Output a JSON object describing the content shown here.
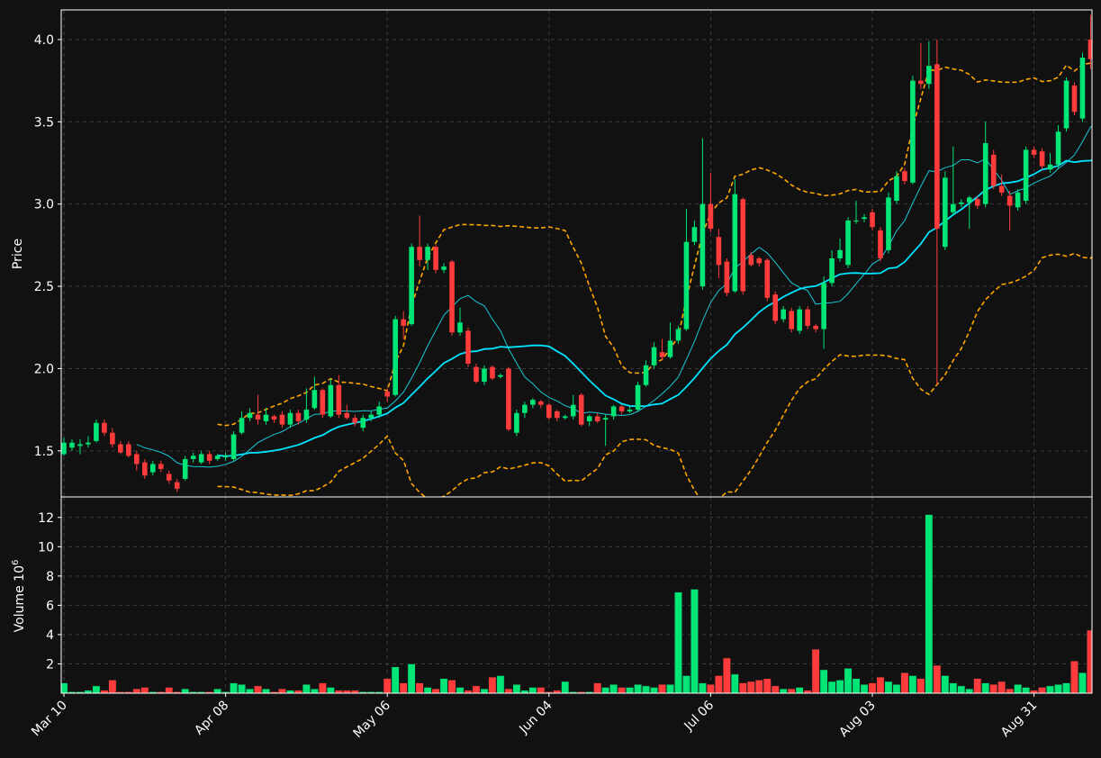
{
  "colors": {
    "background": "#111111",
    "up": "#00e676",
    "down": "#ff3b3b",
    "ma_fast": "#18c8d8",
    "ma_slow": "#00e5ff",
    "bollinger": "#ffa500",
    "grid": "#3a3a3a",
    "frame": "#ffffff"
  },
  "chart_data": [
    {
      "type": "candlestick",
      "ylabel": "Price",
      "ylim": [
        1.22,
        4.18
      ],
      "y_ticks": [
        "1.5",
        "2.0",
        "2.5",
        "3.0",
        "3.5",
        "4.0"
      ],
      "grid": true,
      "x_start_date": "Mar 10",
      "x_tick_labels": [
        "Mar 10",
        "Apr 08",
        "May 06",
        "Jun 04",
        "Jul 06",
        "Aug 03",
        "Aug 31"
      ],
      "x_tick_indices": [
        0,
        20,
        40,
        60,
        80,
        100,
        120
      ],
      "ohlc": [
        [
          1.48,
          1.55,
          1.47,
          1.58
        ],
        [
          1.52,
          1.55,
          1.5,
          1.57
        ],
        [
          1.53,
          1.54,
          1.48,
          1.57
        ],
        [
          1.54,
          1.55,
          1.52,
          1.59
        ],
        [
          1.56,
          1.67,
          1.55,
          1.69
        ],
        [
          1.67,
          1.61,
          1.59,
          1.69
        ],
        [
          1.61,
          1.54,
          1.52,
          1.64
        ],
        [
          1.54,
          1.49,
          1.48,
          1.56
        ],
        [
          1.54,
          1.47,
          1.46,
          1.56
        ],
        [
          1.48,
          1.42,
          1.38,
          1.5
        ],
        [
          1.43,
          1.35,
          1.33,
          1.45
        ],
        [
          1.37,
          1.42,
          1.35,
          1.44
        ],
        [
          1.42,
          1.39,
          1.37,
          1.44
        ],
        [
          1.36,
          1.32,
          1.3,
          1.38
        ],
        [
          1.31,
          1.27,
          1.25,
          1.33
        ],
        [
          1.33,
          1.45,
          1.32,
          1.47
        ],
        [
          1.45,
          1.47,
          1.43,
          1.49
        ],
        [
          1.43,
          1.48,
          1.42,
          1.5
        ],
        [
          1.48,
          1.44,
          1.42,
          1.5
        ],
        [
          1.45,
          1.47,
          1.44,
          1.48
        ],
        [
          1.46,
          1.47,
          1.44,
          1.49
        ],
        [
          1.45,
          1.6,
          1.44,
          1.62
        ],
        [
          1.61,
          1.7,
          1.6,
          1.74
        ],
        [
          1.7,
          1.73,
          1.68,
          1.76
        ],
        [
          1.72,
          1.69,
          1.66,
          1.84
        ],
        [
          1.68,
          1.72,
          1.66,
          1.76
        ],
        [
          1.71,
          1.69,
          1.67,
          1.72
        ],
        [
          1.72,
          1.66,
          1.64,
          1.74
        ],
        [
          1.66,
          1.73,
          1.64,
          1.75
        ],
        [
          1.73,
          1.68,
          1.66,
          1.75
        ],
        [
          1.69,
          1.75,
          1.67,
          1.88
        ],
        [
          1.76,
          1.87,
          1.75,
          1.95
        ],
        [
          1.87,
          1.72,
          1.7,
          1.88
        ],
        [
          1.71,
          1.9,
          1.7,
          1.94
        ],
        [
          1.9,
          1.72,
          1.7,
          1.96
        ],
        [
          1.73,
          1.7,
          1.69,
          1.78
        ],
        [
          1.7,
          1.67,
          1.65,
          1.72
        ],
        [
          1.64,
          1.7,
          1.62,
          1.72
        ],
        [
          1.7,
          1.72,
          1.68,
          1.74
        ],
        [
          1.72,
          1.77,
          1.7,
          1.8
        ],
        [
          1.86,
          1.83,
          1.8,
          1.88
        ],
        [
          1.84,
          2.3,
          1.83,
          2.32
        ],
        [
          2.3,
          2.26,
          2.18,
          2.35
        ],
        [
          2.27,
          2.74,
          2.26,
          2.76
        ],
        [
          2.74,
          2.66,
          2.62,
          2.93
        ],
        [
          2.66,
          2.74,
          2.6,
          2.76
        ],
        [
          2.74,
          2.6,
          2.58,
          2.75
        ],
        [
          2.6,
          2.62,
          2.58,
          2.64
        ],
        [
          2.65,
          2.22,
          2.2,
          2.66
        ],
        [
          2.22,
          2.28,
          2.2,
          2.37
        ],
        [
          2.23,
          2.03,
          2.01,
          2.25
        ],
        [
          2.01,
          1.92,
          1.91,
          2.03
        ],
        [
          1.92,
          2.0,
          1.9,
          2.02
        ],
        [
          2.01,
          1.94,
          1.93,
          2.02
        ],
        [
          1.95,
          1.96,
          1.94,
          1.97
        ],
        [
          2.0,
          1.63,
          1.62,
          2.01
        ],
        [
          1.61,
          1.73,
          1.59,
          1.75
        ],
        [
          1.73,
          1.78,
          1.7,
          1.8
        ],
        [
          1.78,
          1.81,
          1.76,
          1.82
        ],
        [
          1.8,
          1.78,
          1.76,
          1.81
        ],
        [
          1.78,
          1.7,
          1.69,
          1.79
        ],
        [
          1.74,
          1.7,
          1.68,
          1.75
        ],
        [
          1.7,
          1.71,
          1.69,
          1.72
        ],
        [
          1.71,
          1.78,
          1.69,
          1.84
        ],
        [
          1.84,
          1.66,
          1.65,
          1.85
        ],
        [
          1.68,
          1.71,
          1.65,
          1.72
        ],
        [
          1.71,
          1.68,
          1.67,
          1.73
        ],
        [
          1.69,
          1.7,
          1.53,
          1.72
        ],
        [
          1.71,
          1.77,
          1.69,
          1.78
        ],
        [
          1.77,
          1.74,
          1.72,
          1.78
        ],
        [
          1.74,
          1.75,
          1.73,
          1.77
        ],
        [
          1.75,
          1.9,
          1.74,
          1.92
        ],
        [
          1.9,
          2.02,
          1.89,
          2.05
        ],
        [
          2.02,
          2.13,
          2.0,
          2.16
        ],
        [
          2.1,
          2.07,
          2.05,
          2.18
        ],
        [
          2.07,
          2.17,
          2.06,
          2.28
        ],
        [
          2.17,
          2.24,
          2.15,
          2.26
        ],
        [
          2.24,
          2.77,
          2.23,
          2.97
        ],
        [
          2.77,
          2.86,
          2.75,
          2.9
        ],
        [
          2.5,
          3.0,
          2.48,
          3.4
        ],
        [
          3.0,
          2.85,
          2.83,
          3.19
        ],
        [
          2.8,
          2.63,
          2.55,
          2.85
        ],
        [
          2.65,
          2.46,
          2.44,
          2.67
        ],
        [
          2.47,
          3.06,
          2.46,
          3.15
        ],
        [
          3.03,
          2.47,
          2.45,
          3.04
        ],
        [
          2.69,
          2.63,
          2.62,
          2.71
        ],
        [
          2.67,
          2.64,
          2.62,
          2.68
        ],
        [
          2.66,
          2.43,
          2.41,
          2.67
        ],
        [
          2.45,
          2.29,
          2.27,
          2.47
        ],
        [
          2.3,
          2.36,
          2.28,
          2.38
        ],
        [
          2.35,
          2.24,
          2.22,
          2.37
        ],
        [
          2.23,
          2.36,
          2.21,
          2.38
        ],
        [
          2.36,
          2.26,
          2.24,
          2.38
        ],
        [
          2.26,
          2.24,
          2.22,
          2.27
        ],
        [
          2.24,
          2.52,
          2.12,
          2.56
        ],
        [
          2.52,
          2.67,
          2.5,
          2.72
        ],
        [
          2.67,
          2.72,
          2.65,
          2.79
        ],
        [
          2.63,
          2.9,
          2.61,
          2.92
        ],
        [
          2.9,
          2.9,
          2.88,
          3.02
        ],
        [
          2.91,
          2.92,
          2.89,
          2.94
        ],
        [
          2.95,
          2.86,
          2.84,
          2.97
        ],
        [
          2.84,
          2.67,
          2.65,
          2.86
        ],
        [
          2.72,
          3.04,
          2.7,
          3.07
        ],
        [
          3.02,
          3.17,
          3.0,
          3.2
        ],
        [
          3.2,
          3.14,
          3.12,
          3.22
        ],
        [
          3.13,
          3.75,
          3.12,
          3.78
        ],
        [
          3.75,
          3.73,
          3.7,
          3.98
        ],
        [
          3.73,
          3.84,
          3.7,
          3.99
        ],
        [
          3.85,
          2.85,
          1.9,
          4.0
        ],
        [
          2.74,
          3.16,
          2.72,
          3.2
        ],
        [
          2.95,
          3.0,
          2.93,
          3.35
        ],
        [
          3.0,
          3.01,
          2.98,
          3.03
        ],
        [
          3.01,
          3.04,
          2.85,
          3.05
        ],
        [
          3.03,
          2.99,
          2.97,
          3.05
        ],
        [
          3.0,
          3.37,
          2.98,
          3.5
        ],
        [
          3.3,
          3.11,
          3.09,
          3.33
        ],
        [
          3.11,
          3.07,
          3.05,
          3.18
        ],
        [
          3.05,
          2.99,
          2.84,
          3.08
        ],
        [
          2.98,
          3.07,
          2.96,
          3.09
        ],
        [
          3.02,
          3.33,
          3.0,
          3.35
        ],
        [
          3.33,
          3.3,
          3.28,
          3.35
        ],
        [
          3.32,
          3.23,
          3.21,
          3.34
        ],
        [
          3.21,
          3.24,
          3.19,
          3.31
        ],
        [
          3.24,
          3.44,
          3.22,
          3.48
        ],
        [
          3.46,
          3.75,
          3.44,
          3.77
        ],
        [
          3.72,
          3.56,
          3.54,
          3.74
        ],
        [
          3.52,
          3.89,
          3.5,
          3.92
        ],
        [
          4.0,
          3.88,
          3.82,
          4.15
        ],
        [
          3.47,
          3.38,
          3.13,
          4.12
        ]
      ],
      "volume_millions": [
        0.7,
        0.1,
        0.1,
        0.2,
        0.5,
        0.2,
        0.9,
        0.1,
        0.1,
        0.3,
        0.4,
        0.1,
        0.1,
        0.4,
        0.1,
        0.3,
        0.1,
        0.1,
        0.1,
        0.3,
        0.1,
        0.7,
        0.6,
        0.3,
        0.5,
        0.3,
        0.1,
        0.3,
        0.2,
        0.2,
        0.6,
        0.3,
        0.7,
        0.4,
        0.2,
        0.2,
        0.2,
        0.1,
        0.1,
        0.1,
        1.0,
        1.8,
        0.7,
        2.0,
        0.7,
        0.4,
        0.3,
        1.0,
        0.9,
        0.4,
        0.2,
        0.5,
        0.3,
        1.1,
        1.2,
        0.3,
        0.6,
        0.2,
        0.4,
        0.4,
        0.1,
        0.2,
        0.8,
        0.1,
        0.1,
        0.1,
        0.7,
        0.4,
        0.6,
        0.4,
        0.4,
        0.6,
        0.5,
        0.4,
        0.6,
        0.6,
        6.9,
        1.2,
        7.1,
        0.7,
        0.6,
        1.2,
        2.4,
        1.3,
        0.7,
        0.8,
        0.9,
        1.0,
        0.5,
        0.3,
        0.3,
        0.4,
        0.2,
        3.0,
        1.6,
        0.8,
        0.9,
        1.7,
        1.0,
        0.6,
        0.7,
        1.1,
        0.8,
        0.6,
        1.4,
        1.2,
        1.0,
        12.2,
        1.9,
        1.2,
        0.7,
        0.5,
        0.3,
        1.0,
        0.7,
        0.6,
        0.8,
        0.3,
        0.6,
        0.4,
        0.2,
        0.4,
        0.5,
        0.6,
        0.7,
        2.2,
        1.4,
        4.3
      ],
      "volume_ylabel": "Volume  10^6",
      "volume_ylim": [
        0,
        13.4
      ],
      "volume_ticks": [
        "2",
        "4",
        "6",
        "8",
        "10",
        "12"
      ],
      "overlays": [
        "moving average 10",
        "moving average 20",
        "bollinger bands"
      ]
    }
  ]
}
